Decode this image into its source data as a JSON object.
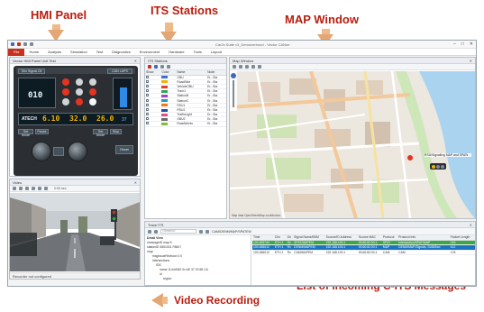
{
  "annotations": {
    "hmi": "HMI Panel",
    "stations": "ITS Stations",
    "map": "MAP Window",
    "video": "Video Recording",
    "messages": "List of incoming C-ITS Messages"
  },
  "app": {
    "title": "Car2x.Suite v3_Demoverbund - Vector CANoe",
    "menu": [
      "File",
      "Home",
      "Analysis",
      "Simulation",
      "Test",
      "Diagnostics",
      "Environment",
      "Hardware",
      "Tools",
      "Layout"
    ]
  },
  "hmi": {
    "header": "Vector HMI Panel Unit Test",
    "top_left_label": "Sim Signal Ctl",
    "top_right_label": "CAN LAPS",
    "brand": "ATECH",
    "lcd_primary": "010",
    "readouts": [
      "6.10",
      "32.0",
      "26.0"
    ],
    "bar_value": "37",
    "buttons": [
      "Set Mode",
      "Pause",
      "Set Mode",
      "Stop",
      "Reset"
    ]
  },
  "video": {
    "header": "Video",
    "timestamp": "0:00 sec",
    "status": "Recorder not configured"
  },
  "stations": {
    "header": "ITS Stations",
    "columns": [
      "Show",
      "Color",
      "Name",
      "Node"
    ],
    "rows": [
      {
        "name": "OBU",
        "node": "Er...Sta",
        "color": "#3b6fd6"
      },
      {
        "name": "RoadSide",
        "node": "Er...Sta",
        "color": "#f3b400"
      },
      {
        "name": "VehicleOBU",
        "node": "Er...Sta",
        "color": "#e0412c"
      },
      {
        "name": "Tram1",
        "node": "Er...Sta",
        "color": "#32a853"
      },
      {
        "name": "StationB",
        "node": "Er...Sta",
        "color": "#a541c6"
      },
      {
        "name": "StationC",
        "node": "Er...Sta",
        "color": "#1f9fb5"
      },
      {
        "name": "RSU1",
        "node": "Er...Sta",
        "color": "#f07a1a"
      },
      {
        "name": "RSU2",
        "node": "Er...Sta",
        "color": "#1f4fa8"
      },
      {
        "name": "TrafficLight",
        "node": "Er...Sta",
        "color": "#e74c8a"
      },
      {
        "name": "OBU2",
        "node": "Er...Sta",
        "color": "#6a6a6a"
      },
      {
        "name": "RoadWorks",
        "node": "Er...Sta",
        "color": "#88b83a"
      }
    ]
  },
  "map": {
    "header": "Map Window",
    "poi_label": "RSU/Signalling MAP and SPATs",
    "footer": "Map data OpenStreetMap contributors"
  },
  "trace": {
    "header": "Trace ITS",
    "search_placeholder": "<Search>",
    "filter_label": "CAM/DENM/MAP/SPATEM",
    "detail_header": "Detail View",
    "detail_lines": [
      "messageID    map    5",
      "stationID    5551001    F8847",
      "map",
      "msgIssueRevision    0    0",
      "intersections",
      "IDS",
      "name    11444052    0x AE 37 20 58 CA",
      "id",
      "region"
    ],
    "columns": [
      "Time",
      "Chn",
      "Dir",
      "Signal Name/BSM",
      "Source/ID Address",
      "Source MAC",
      "Protocol",
      "Protocol Info",
      "Packet Length"
    ],
    "rows": [
      {
        "time": "100.483744",
        "chn": "ETH 1",
        "dir": "Rx",
        "signal": "SPAT/MAPEM",
        "src": "192.168.100.1",
        "mac": "00:60:82:00:1",
        "proto": "SPAT",
        "info": "Intersection/SPAT/MAP",
        "len": "215",
        "style": "green"
      },
      {
        "time": "100.485512",
        "chn": "ETH 1",
        "dir": "Rx",
        "signal": "DENM/MAPEM",
        "src": "192.168.100.1",
        "mac": "00:60:82:00:1",
        "proto": "MAP",
        "info": "DENM/MAP/Signals, SUB/Bed",
        "len": "412",
        "style": "sel"
      },
      {
        "time": "100.486010",
        "chn": "ETH 1",
        "dir": "Rx",
        "signal": "CAM/MAPEM",
        "src": "192.168.100.1",
        "mac": "00:60:82:00:1",
        "proto": "CAM",
        "info": "CAM",
        "len": "178",
        "style": "plain"
      }
    ]
  }
}
